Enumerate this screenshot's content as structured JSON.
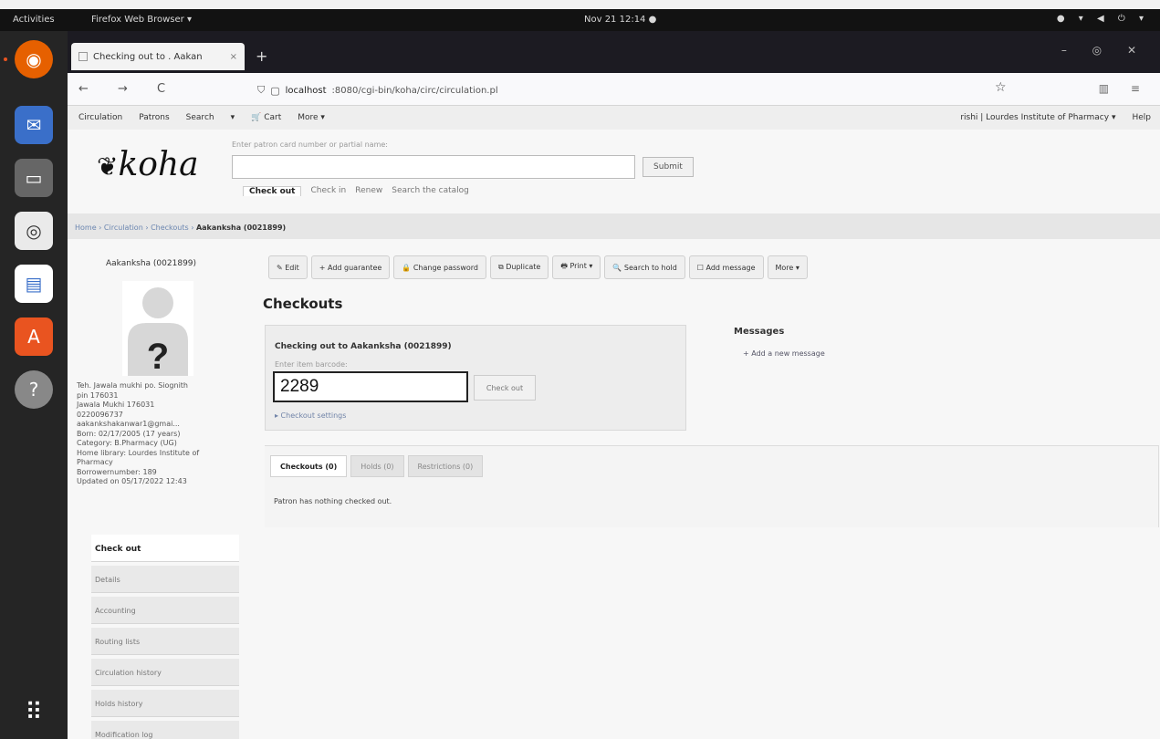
{
  "topbar": {
    "activities": "Activities",
    "app_menu": "Firefox Web Browser ▾",
    "clock": "Nov 21  12:14 ●",
    "tray": "● ▾ ◀ ⏻ ▾"
  },
  "dock": {
    "items": [
      {
        "name": "firefox-icon",
        "glyph": "◉"
      },
      {
        "name": "thunderbird-icon",
        "glyph": "✉"
      },
      {
        "name": "files-icon",
        "glyph": "▭"
      },
      {
        "name": "rhythmbox-icon",
        "glyph": "◎"
      },
      {
        "name": "writer-icon",
        "glyph": "▤"
      },
      {
        "name": "software-icon",
        "glyph": "A"
      },
      {
        "name": "help-icon",
        "glyph": "?"
      }
    ],
    "apps_grid": "⠿"
  },
  "browser": {
    "tab_title": "Checking out to . Aakan",
    "tab_close": "×",
    "new_tab": "+",
    "win_controls": "– ◎ ✕",
    "nav_buttons": "← → C",
    "url_host": "localhost",
    "url_path": ":8080/cgi-bin/koha/circ/circulation.pl",
    "star": "☆",
    "right_icons": "▥ ≡"
  },
  "koha": {
    "navbar_left": [
      "Circulation",
      "Patrons",
      "Search",
      "▾",
      "🛒 Cart",
      "More ▾"
    ],
    "navbar_right": [
      "rishi | Lourdes Institute of Pharmacy ▾",
      "Help"
    ],
    "logo": "koha",
    "search_hint": "Enter patron card number or partial name:",
    "search_button": "Submit",
    "search_tabs": [
      "Check out",
      "Check in",
      "Renew",
      "Search the catalog"
    ],
    "breadcrumb_home": "Home",
    "breadcrumb_circulation": "Circulation",
    "breadcrumb_checkouts": "Checkouts",
    "breadcrumb_sep": "›",
    "breadcrumb_current": "Aakanksha (0021899)",
    "patron": {
      "name": "Aakanksha (0021899)",
      "info": [
        "Teh. Jawala mukhi po. Siognith",
        "pin 176031",
        "Jawala Mukhi 176031",
        "0220096737",
        "aakankshakanwar1@gmai...",
        "Born: 02/17/2005 (17 years)",
        "Category: B.Pharmacy (UG)",
        "Home library: Lourdes Institute of",
        "Pharmacy",
        "Borrowernumber: 189",
        "Updated on 05/17/2022 12:43"
      ]
    },
    "side_menu": [
      "Check out",
      "Details",
      "Accounting",
      "Routing lists",
      "Circulation history",
      "Holds history",
      "Modification log"
    ],
    "toolbar": [
      "✎ Edit",
      "+ Add guarantee",
      "🔒 Change password",
      "⧉ Duplicate",
      "🖶 Print ▾",
      "🔍 Search to hold",
      "☐ Add message",
      "More ▾"
    ],
    "page_title": "Checkouts",
    "checkout": {
      "heading": "Checking out to Aakanksha (0021899)",
      "label": "Enter item barcode:",
      "barcode_value": "2289",
      "button": "Check out",
      "settings": "▸ Checkout settings"
    },
    "messages": {
      "heading": "Messages",
      "add": "+ Add a new message"
    },
    "tabs": [
      "Checkouts (0)",
      "Holds (0)",
      "Restrictions (0)"
    ],
    "tab_content": "Patron has nothing checked out."
  }
}
